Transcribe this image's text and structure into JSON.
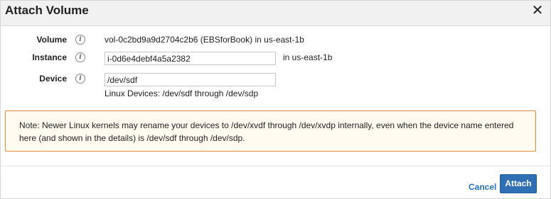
{
  "dialog": {
    "title": "Attach Volume",
    "close_glyph": "✕"
  },
  "form": {
    "volume": {
      "label": "Volume",
      "value": "vol-0c2bd9a9d2704c2b6 (EBSforBook) in us-east-1b"
    },
    "instance": {
      "label": "Instance",
      "value": "i-0d6e4debf4a5a2382",
      "suffix": "in us-east-1b"
    },
    "device": {
      "label": "Device",
      "value": "/dev/sdf",
      "hint": "Linux Devices: /dev/sdf through /dev/sdp"
    },
    "info_glyph": "i"
  },
  "note": {
    "text": "Note: Newer Linux kernels may rename your devices to /dev/xvdf through /dev/xvdp internally, even when the device name entered here (and shown in the details) is /dev/sdf through /dev/sdp."
  },
  "footer": {
    "cancel_label": "Cancel",
    "attach_label": "Attach"
  },
  "colors": {
    "note_border": "#e0893a",
    "note_background": "#fffbf0",
    "primary_button": "#2f6fb3",
    "link": "#2573c4"
  },
  "icons": {
    "close": "close-icon",
    "info": "info-icon"
  }
}
